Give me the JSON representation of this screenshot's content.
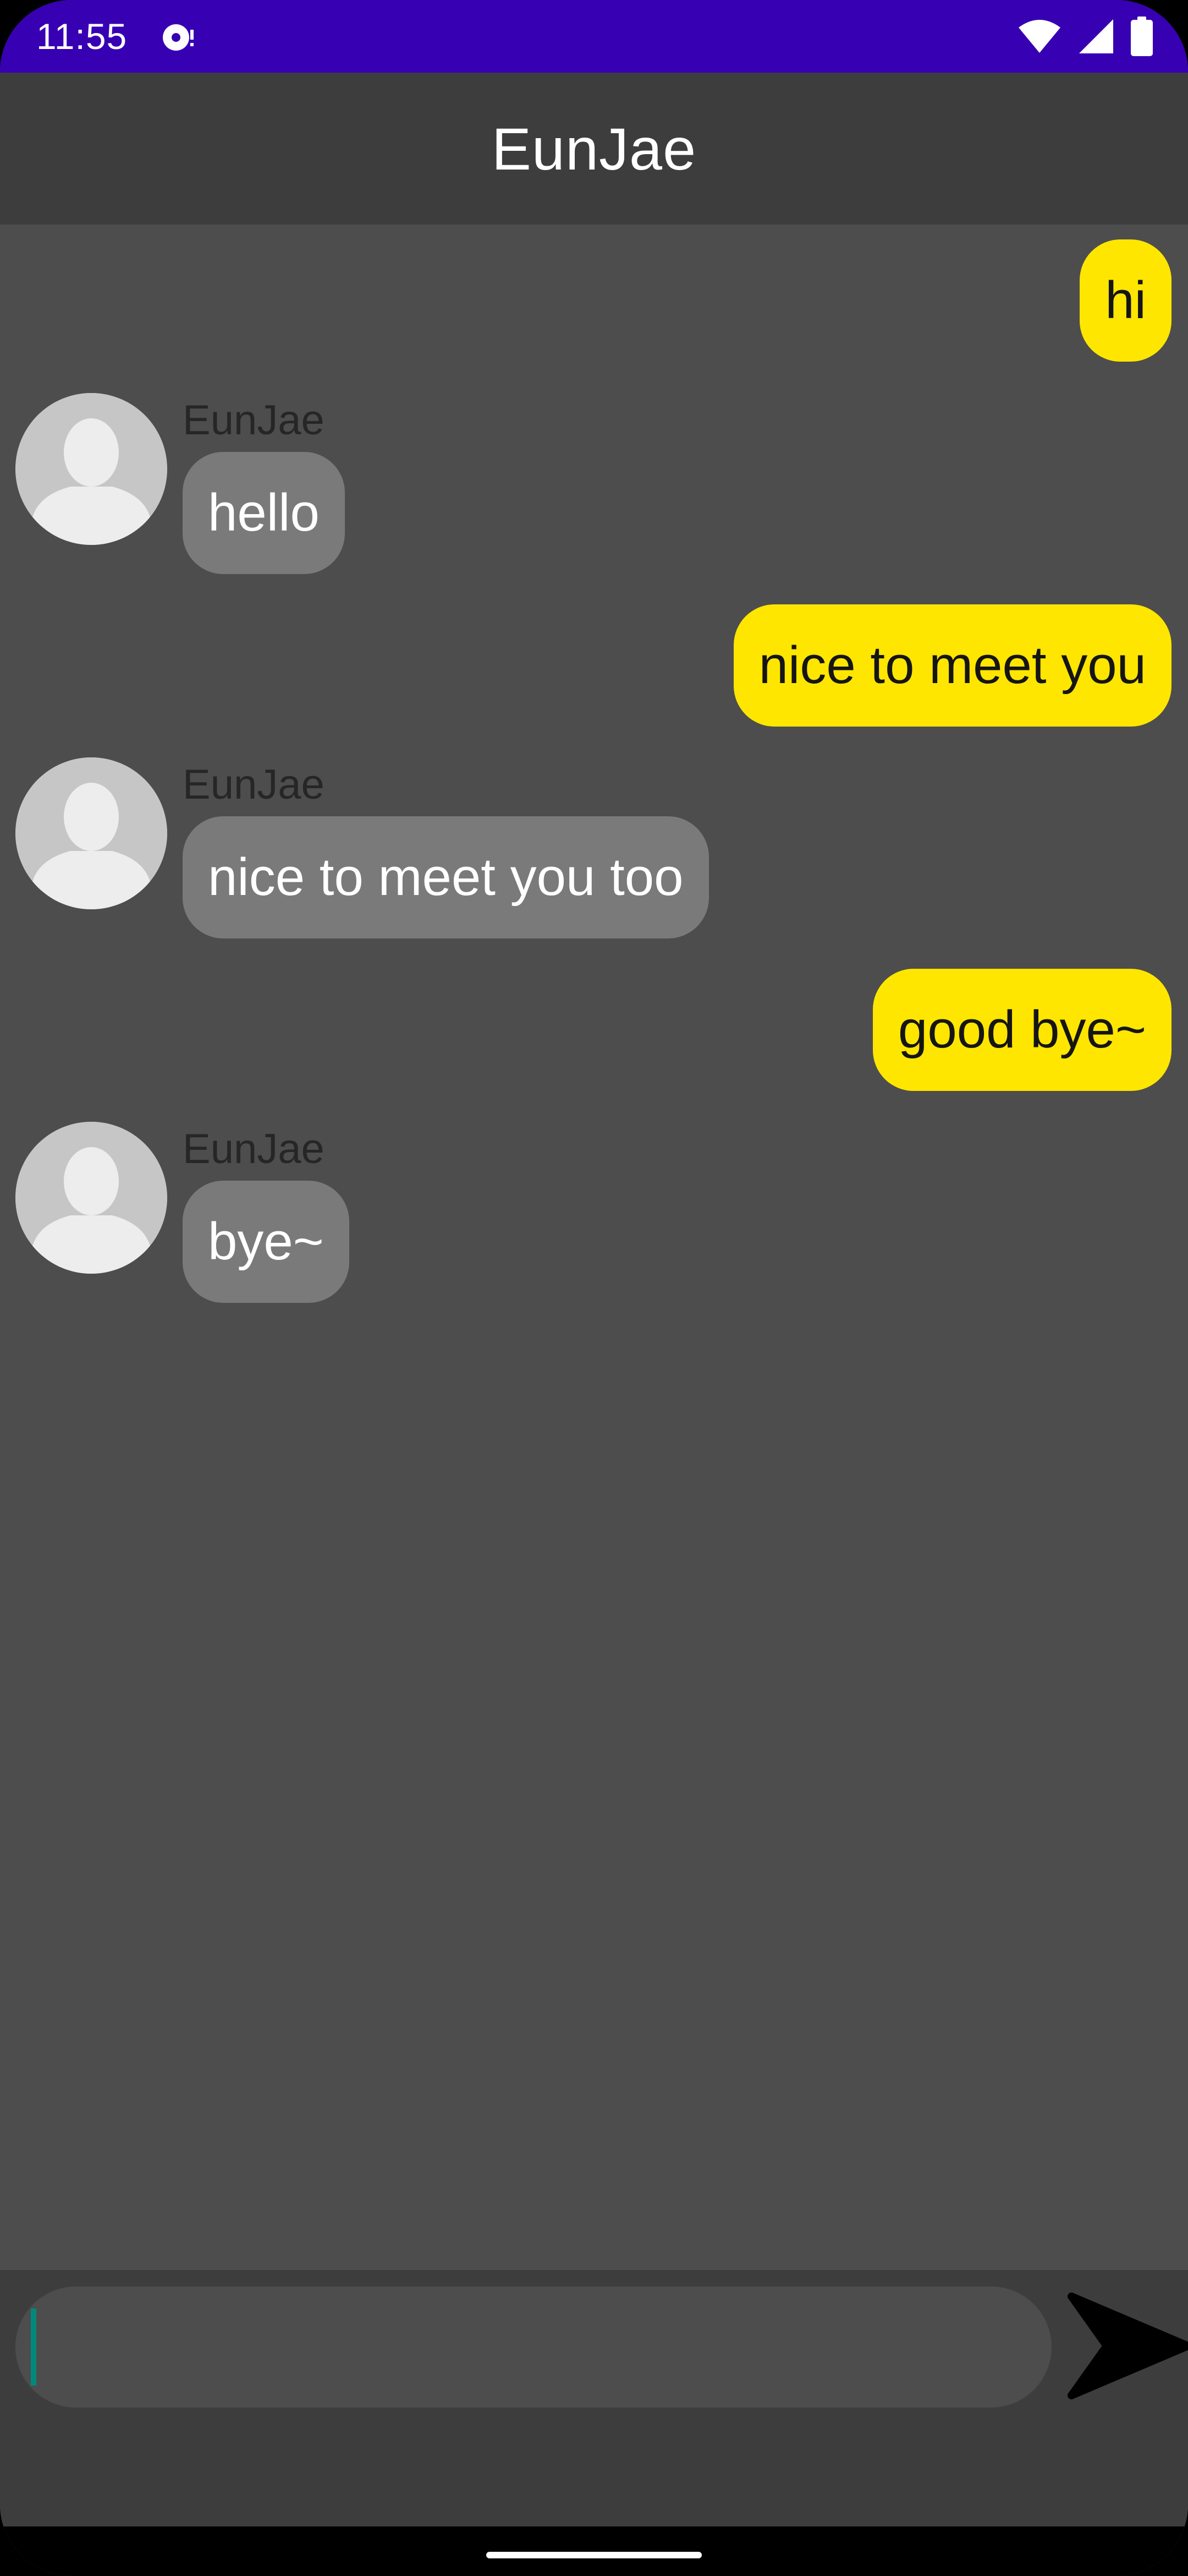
{
  "status_bar": {
    "time": "11:55",
    "icons": [
      "media-notification-icon",
      "wifi-icon",
      "cellular-signal-icon",
      "battery-icon"
    ],
    "background_color": "#3700b3"
  },
  "app_bar": {
    "title": "EunJae",
    "background_color": "#3d3d3d"
  },
  "messages": [
    {
      "from": "me",
      "text": "hi"
    },
    {
      "from": "them",
      "sender": "EunJae",
      "text": "hello"
    },
    {
      "from": "me",
      "text": "nice to meet you"
    },
    {
      "from": "them",
      "sender": "EunJae",
      "text": "nice to meet you too"
    },
    {
      "from": "me",
      "text": "good bye~"
    },
    {
      "from": "them",
      "sender": "EunJae",
      "text": "bye~"
    }
  ],
  "colors": {
    "my_bubble": "#ffe600",
    "their_bubble": "#7a7a7a",
    "chat_background": "#4d4d4d"
  },
  "input": {
    "value": "",
    "placeholder": ""
  },
  "send_button": {
    "icon": "send-icon"
  }
}
